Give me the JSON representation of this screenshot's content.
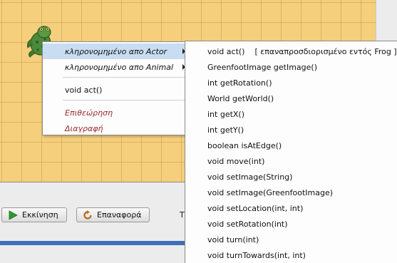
{
  "colors": {
    "world_background": "#f5cf7b",
    "menu_selected": "#c8ddf2",
    "danger_text": "#9b2a2a",
    "status_bar": "#3d70b7",
    "frog": "#4d8a3a"
  },
  "world": {
    "actor_icon": "frog-icon"
  },
  "controls": {
    "run_label": "Εκκίνηση",
    "run_icon": "play-icon",
    "reset_label": "Επαναφορά",
    "reset_icon": "reset-icon",
    "speed_label_partial": "Τ"
  },
  "context_menu": {
    "inherited_actor": "κληρονομημένο απο Actor",
    "inherited_animal": "κληρονομημένο απο Animal",
    "act": "void act()",
    "inspect": "Επιθεώρηση",
    "delete": "Διαγραφή",
    "submenu_arrow_icon": "chevron-right-icon"
  },
  "submenu": {
    "items": [
      {
        "label": "void act()",
        "note": "[ επαναπροσδιορισμένο εντός Frog ]"
      },
      {
        "label": "GreenfootImage getImage()"
      },
      {
        "label": "int getRotation()"
      },
      {
        "label": "World getWorld()"
      },
      {
        "label": "int getX()"
      },
      {
        "label": "int getY()"
      },
      {
        "label": "boolean isAtEdge()"
      },
      {
        "label": "void move(int)"
      },
      {
        "label": "void setImage(String)"
      },
      {
        "label": "void setImage(GreenfootImage)"
      },
      {
        "label": "void setLocation(int, int)"
      },
      {
        "label": "void setRotation(int)"
      },
      {
        "label": "void turn(int)"
      },
      {
        "label": "void turnTowards(int, int)"
      }
    ]
  }
}
